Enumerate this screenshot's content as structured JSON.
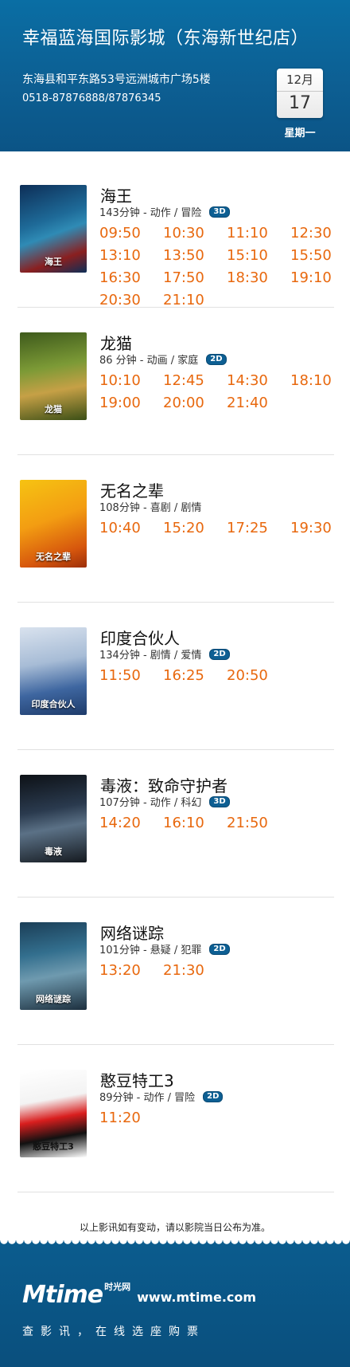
{
  "cinema": {
    "name": "幸福蓝海国际影城（东海新世纪店）",
    "address": "东海县和平东路53号远洲城市广场5楼",
    "phone": "0518-87876888/87876345"
  },
  "date": {
    "month": "12月",
    "day": "17",
    "weekday": "星期一"
  },
  "movies": [
    {
      "title": "海王",
      "meta": "143分钟 - 动作 / 冒险",
      "format": "3D",
      "poster_label": "海王",
      "times": [
        "09:50",
        "10:30",
        "11:10",
        "12:30",
        "13:10",
        "13:50",
        "15:10",
        "15:50",
        "16:30",
        "17:50",
        "18:30",
        "19:10",
        "20:30",
        "21:10"
      ]
    },
    {
      "title": "龙猫",
      "meta": "86 分钟 - 动画 / 家庭",
      "format": "2D",
      "poster_label": "龙猫",
      "times": [
        "10:10",
        "12:45",
        "14:30",
        "18:10",
        "19:00",
        "20:00",
        "21:40"
      ]
    },
    {
      "title": "无名之辈",
      "meta": "108分钟 - 喜剧 / 剧情",
      "format": "",
      "poster_label": "无名之辈",
      "times": [
        "10:40",
        "15:20",
        "17:25",
        "19:30"
      ]
    },
    {
      "title": "印度合伙人",
      "meta": "134分钟 - 剧情 / 爱情",
      "format": "2D",
      "poster_label": "印度合伙人",
      "times": [
        "11:50",
        "16:25",
        "20:50"
      ]
    },
    {
      "title": "毒液：致命守护者",
      "meta": "107分钟 - 动作 / 科幻",
      "format": "3D",
      "poster_label": "毒液",
      "times": [
        "14:20",
        "16:10",
        "21:50"
      ]
    },
    {
      "title": "网络谜踪",
      "meta": "101分钟 - 悬疑 / 犯罪",
      "format": "2D",
      "poster_label": "网络谜踪",
      "times": [
        "13:20",
        "21:30"
      ]
    },
    {
      "title": "憨豆特工3",
      "meta": "89分钟 - 动作 / 冒险",
      "format": "2D",
      "poster_label": "憨豆特工3",
      "times": [
        "11:20"
      ]
    }
  ],
  "notice": "以上影讯如有变动，请以影院当日公布为准。",
  "footer": {
    "brand": "Mtime",
    "brand_cn": "时光网",
    "url": "www.mtime.com",
    "slogan": "查影讯，在线选座购票"
  },
  "colors": {
    "header_blue": "#0d5f93",
    "showtime_orange": "#e8680e"
  }
}
